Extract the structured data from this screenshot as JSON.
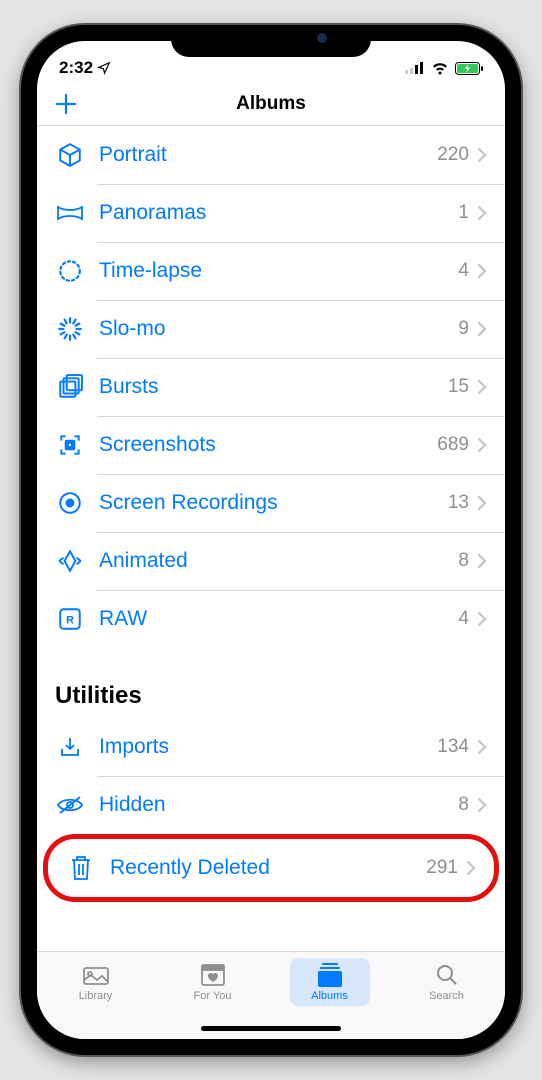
{
  "status": {
    "time": "2:32",
    "location_glyph": "➤"
  },
  "nav": {
    "title": "Albums",
    "add_label": "＋"
  },
  "media_types": [
    {
      "icon": "cube",
      "label": "Portrait",
      "count": "220"
    },
    {
      "icon": "pano",
      "label": "Panoramas",
      "count": "1"
    },
    {
      "icon": "timelapse",
      "label": "Time-lapse",
      "count": "4"
    },
    {
      "icon": "slomo",
      "label": "Slo-mo",
      "count": "9"
    },
    {
      "icon": "bursts",
      "label": "Bursts",
      "count": "15"
    },
    {
      "icon": "screenshot",
      "label": "Screenshots",
      "count": "689"
    },
    {
      "icon": "record",
      "label": "Screen Recordings",
      "count": "13"
    },
    {
      "icon": "animated",
      "label": "Animated",
      "count": "8"
    },
    {
      "icon": "raw",
      "label": "RAW",
      "count": "4"
    }
  ],
  "utilities_header": "Utilities",
  "utilities": [
    {
      "icon": "import",
      "label": "Imports",
      "count": "134",
      "highlight": false
    },
    {
      "icon": "hidden",
      "label": "Hidden",
      "count": "8",
      "highlight": false
    },
    {
      "icon": "trash",
      "label": "Recently Deleted",
      "count": "291",
      "highlight": true
    }
  ],
  "tabs": {
    "library": "Library",
    "foryou": "For You",
    "albums": "Albums",
    "search": "Search"
  }
}
